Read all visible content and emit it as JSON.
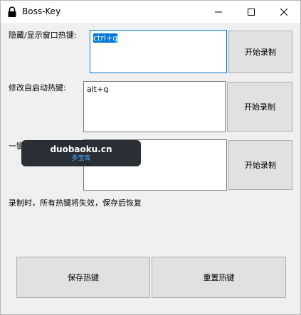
{
  "window": {
    "title": "Boss-Key",
    "icons": {
      "app": "lock-icon",
      "minimize": "minimize-icon",
      "maximize": "maximize-icon",
      "close": "close-icon"
    }
  },
  "hide_show": {
    "label": "隐藏/显示窗口热键:",
    "value": "ctrl+q",
    "record_button": "开始录制"
  },
  "autostart": {
    "label": "修改自启动热键:",
    "value": "alt+q",
    "record_button": "开始录制"
  },
  "third": {
    "label_visible": "一键",
    "value": "",
    "record_button": "开始录制"
  },
  "info": "录制时，所有热键将失效，保存后恢复",
  "footer": {
    "save_button": "保存热键",
    "reset_button": "重置热键"
  },
  "watermark": {
    "main": "duobaoku.cn",
    "sub": "多宝库"
  },
  "colors": {
    "focus_border": "#0078d7",
    "selection": "#0078d7",
    "button_bg": "#e1e1e1",
    "window_bg": "#f0f0f0"
  }
}
